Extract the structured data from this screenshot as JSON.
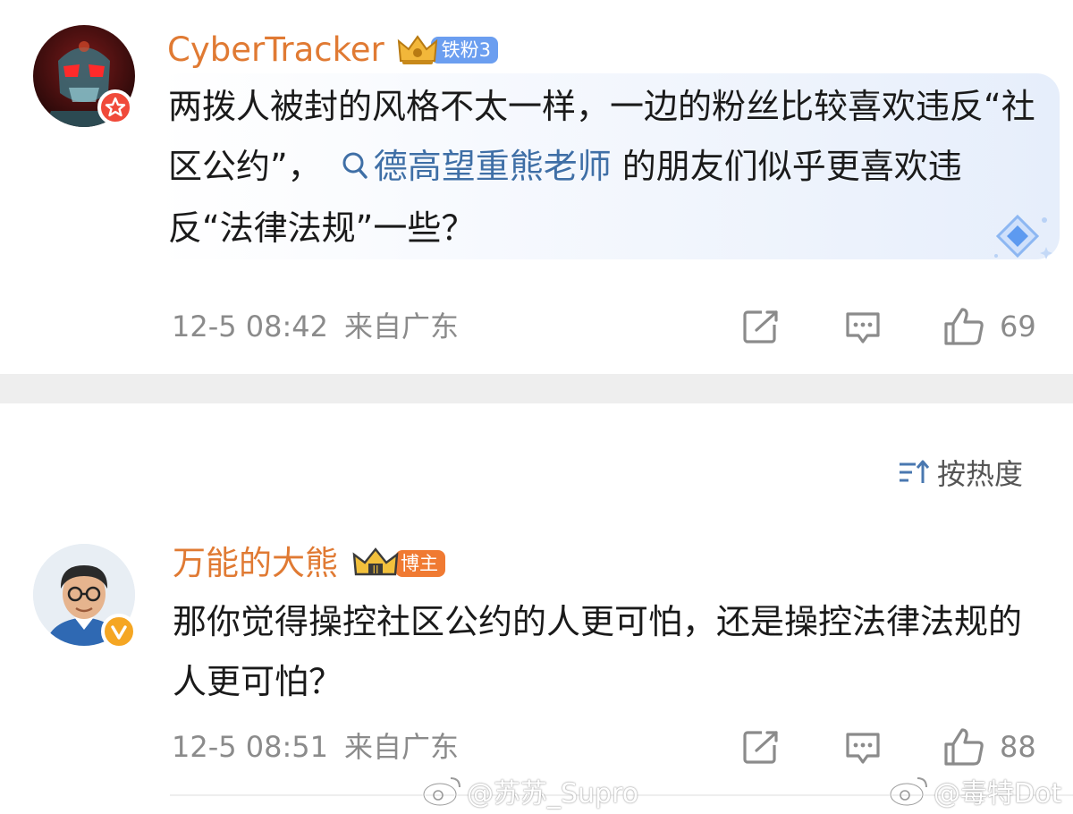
{
  "comments": [
    {
      "username": "CyberTracker",
      "badge_label": "铁粉3",
      "text_before": "两拨人被封的风格不太一样，一边的粉丝比较喜欢违反“社区公约”，",
      "hashtag": "德高望重熊老师",
      "text_after": " 的朋友们似乎更喜欢违反“法律法规”一些？",
      "time": "12-5 08:42",
      "location": "来自广东",
      "likes": "69"
    },
    {
      "username": "万能的大熊",
      "badge_label": "博主",
      "text": "那你觉得操控社区公约的人更可怕，还是操控法律法规的人更可怕？",
      "time": "12-5 08:51",
      "location": "来自广东",
      "likes": "88"
    }
  ],
  "sort_label": "按热度",
  "watermarks": [
    "@苏苏_Supro",
    "@毒特Dot"
  ],
  "colors": {
    "username": "#e07a33",
    "hashtag": "#3f6fa6",
    "meta": "#8b8b8b",
    "fan_badge": "#6b9ef0",
    "blogger_badge": "#f07a32"
  }
}
